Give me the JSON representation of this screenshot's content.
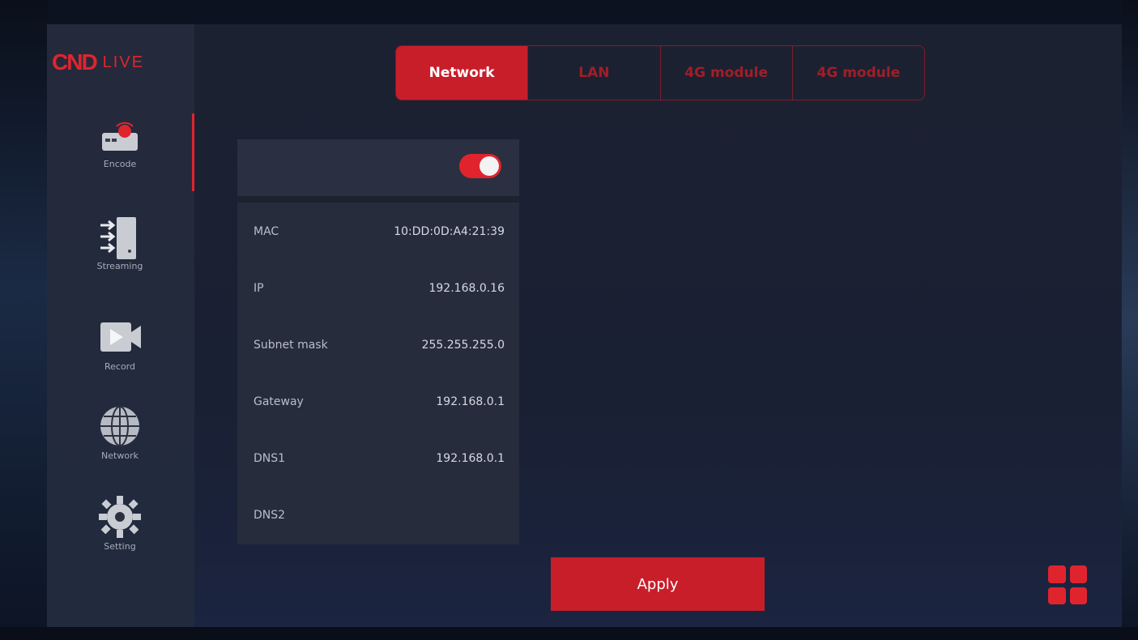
{
  "brand": {
    "logo_main": "CND",
    "logo_sub": "LIVE",
    "accent_color": "#e0242e"
  },
  "sidebar": {
    "items": [
      {
        "label": "Encode",
        "icon": "encoder-icon"
      },
      {
        "label": "Streaming",
        "icon": "streaming-icon"
      },
      {
        "label": "Record",
        "icon": "record-icon"
      },
      {
        "label": "Network",
        "icon": "globe-icon"
      },
      {
        "label": "Setting",
        "icon": "gear-icon"
      }
    ]
  },
  "tabs": [
    {
      "label": "Network",
      "active": true
    },
    {
      "label": "LAN",
      "active": false
    },
    {
      "label": "4G module",
      "active": false
    },
    {
      "label": "4G module",
      "active": false
    }
  ],
  "network_panel": {
    "enabled": true,
    "fields": [
      {
        "label": "MAC",
        "value": "10:DD:0D:A4:21:39"
      },
      {
        "label": "IP",
        "value": "192.168.0.16"
      },
      {
        "label": "Subnet mask",
        "value": "255.255.255.0"
      },
      {
        "label": "Gateway",
        "value": "192.168.0.1"
      },
      {
        "label": "DNS1",
        "value": "192.168.0.1"
      },
      {
        "label": "DNS2",
        "value": ""
      }
    ]
  },
  "actions": {
    "apply_label": "Apply",
    "menu_icon": "grid-menu-icon"
  }
}
